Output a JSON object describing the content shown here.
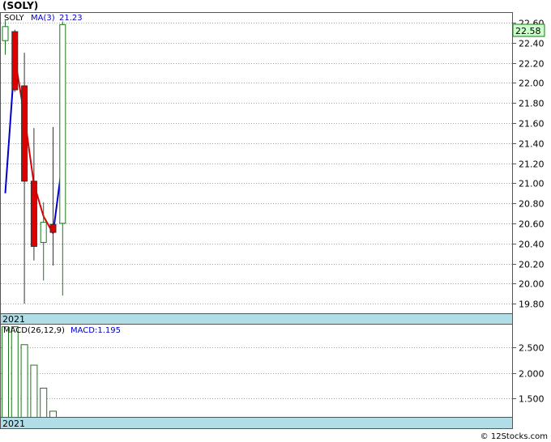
{
  "header": {
    "symbol_title": "(SOLY)",
    "ticker": "SOLY",
    "ma_label": "MA(3)",
    "ma_value": "21.23",
    "macd_label": "MACD(26,12,9)",
    "macd_value_label": "MACD:1.195"
  },
  "year_label": "2021",
  "last_price_label": "22.58",
  "footer": {
    "copyright": "© 12Stocks.com"
  },
  "colors": {
    "up": "#1a7a1a",
    "down": "#dd0000",
    "ma_up": "#0000cc",
    "ma_down": "#dd0000",
    "price_flag": "#ccffcc",
    "year_bar": "#b0dde6",
    "grid": "#aaaaaa"
  },
  "chart_data": [
    {
      "type": "candlestick",
      "title": "(SOLY)",
      "ylim": [
        19.7,
        22.7
      ],
      "yticks": [
        "22.60",
        "22.40",
        "22.20",
        "22.00",
        "21.80",
        "21.60",
        "21.40",
        "21.20",
        "21.00",
        "20.80",
        "20.60",
        "20.40",
        "20.20",
        "20.00",
        "19.80"
      ],
      "candles": [
        {
          "open": 22.42,
          "high": 22.62,
          "low": 22.28,
          "close": 22.56
        },
        {
          "open": 22.51,
          "high": 22.53,
          "low": 21.91,
          "close": 21.93
        },
        {
          "open": 21.97,
          "high": 22.3,
          "low": 19.8,
          "close": 21.02
        },
        {
          "open": 21.02,
          "high": 21.55,
          "low": 20.23,
          "close": 20.37
        },
        {
          "open": 20.41,
          "high": 20.81,
          "low": 20.03,
          "close": 20.61
        },
        {
          "open": 20.59,
          "high": 21.56,
          "low": 20.18,
          "close": 20.51
        },
        {
          "open": 20.6,
          "high": 22.61,
          "low": 19.88,
          "close": 22.58
        }
      ],
      "ma": [
        20.9,
        22.25,
        21.67,
        20.99,
        20.67,
        20.5,
        21.23
      ],
      "grid": true
    },
    {
      "type": "bar",
      "title": "MACD(26,12,9)",
      "ylim": [
        1.13,
        2.95
      ],
      "yticks": [
        "2.500",
        "2.000",
        "1.500"
      ],
      "values": [
        2.9,
        2.9,
        2.55,
        2.15,
        1.7,
        1.25
      ]
    }
  ]
}
